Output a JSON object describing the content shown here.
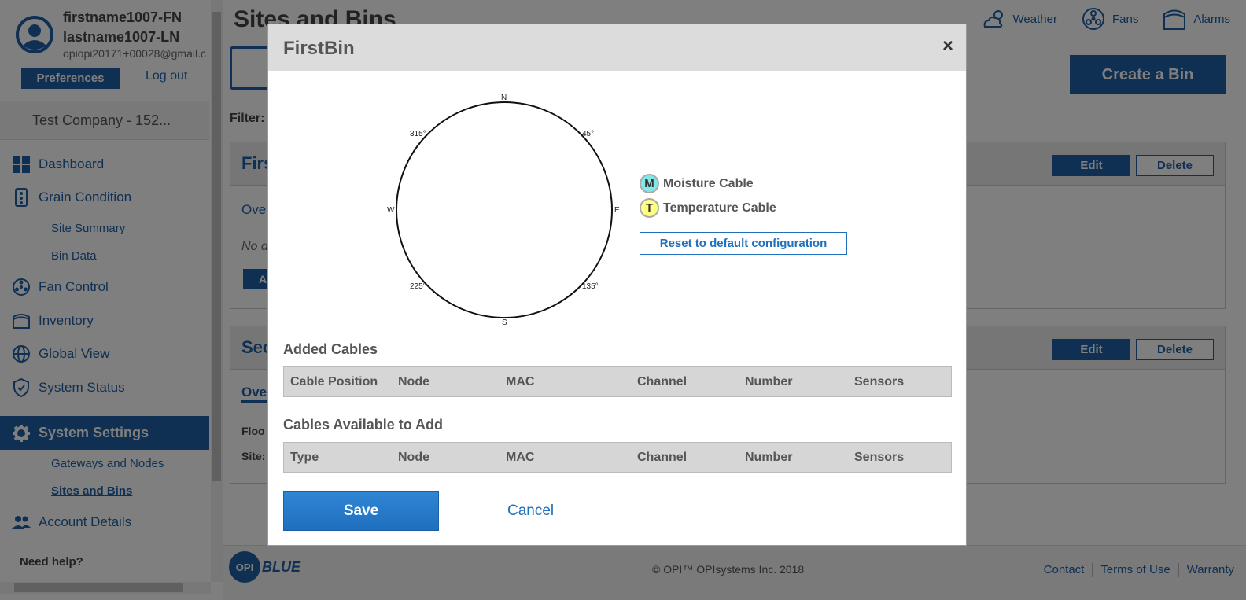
{
  "user": {
    "first_name": "firstname1007-FN",
    "last_name": "lastname1007-LN",
    "email": "opiopi20171+00028@gmail.c",
    "preferences_label": "Preferences",
    "logout_label": "Log out"
  },
  "company": "Test Company - 152...",
  "sidebar": {
    "dashboard": "Dashboard",
    "grain_condition": "Grain Condition",
    "site_summary": "Site Summary",
    "bin_data": "Bin Data",
    "fan_control": "Fan Control",
    "inventory": "Inventory",
    "global_view": "Global View",
    "system_status": "System Status",
    "system_settings": "System Settings",
    "gateways_nodes": "Gateways and Nodes",
    "sites_bins": "Sites and Bins",
    "account_details": "Account Details",
    "need_help": "Need help?"
  },
  "main": {
    "title": "Sites and Bins",
    "weather": "Weather",
    "fans": "Fans",
    "alarms": "Alarms",
    "create_bin": "Create a Bin",
    "filter": "Filter:",
    "card1": {
      "name": "Firs",
      "edit": "Edit",
      "delete": "Delete",
      "overview": "Ove",
      "no_data": "No d",
      "btn": "A"
    },
    "card2": {
      "name": "Sec",
      "edit": "Edit",
      "delete": "Delete",
      "overview": "Ove",
      "floor": "Floo",
      "site": "Site:"
    }
  },
  "footer": {
    "logo_opi": "OPI",
    "logo_blue": "BLUE",
    "copyright": "© OPI™ OPIsystems Inc. 2018",
    "contact": "Contact",
    "terms": "Terms of Use",
    "warranty": "Warranty"
  },
  "modal": {
    "title": "FirstBin",
    "close": "×",
    "compass": {
      "n": "N",
      "e": "E",
      "s": "S",
      "w": "W",
      "d45": "45°",
      "d135": "135°",
      "d225": "225°",
      "d315": "315°"
    },
    "legend": {
      "moisture_letter": "M",
      "moisture_label": "Moisture Cable",
      "temperature_letter": "T",
      "temperature_label": "Temperature Cable"
    },
    "reset_label": "Reset to default configuration",
    "added_title": "Added Cables",
    "added_columns": [
      "Cable Position",
      "Node",
      "MAC",
      "Channel",
      "Number",
      "Sensors"
    ],
    "available_title": "Cables Available to Add",
    "available_columns": [
      "Type",
      "Node",
      "MAC",
      "Channel",
      "Number",
      "Sensors"
    ],
    "save_label": "Save",
    "cancel_label": "Cancel"
  },
  "colors": {
    "brand": "#1f5fa7",
    "moisture": "#80e8e8",
    "temperature": "#ffff80",
    "overlay": "rgba(0,0,0,0.5)"
  }
}
